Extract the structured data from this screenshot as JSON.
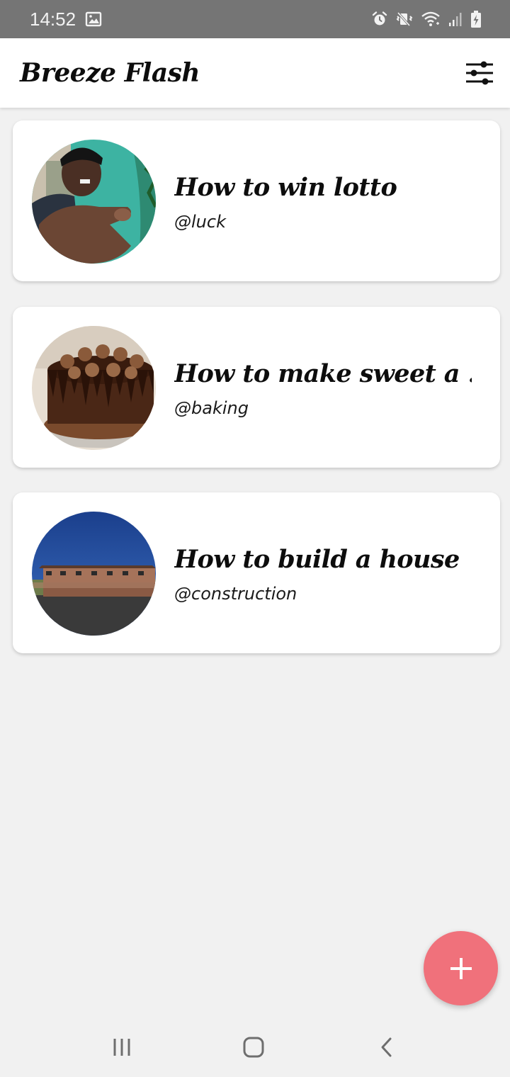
{
  "status_bar": {
    "time": "14:52",
    "icons": [
      "gallery-icon",
      "alarm-icon",
      "vibrate-mute-icon",
      "wifi-icon",
      "signal-icon",
      "battery-charging-icon"
    ]
  },
  "app_bar": {
    "title": "Breeze Flash",
    "filter_icon": "sliders-icon"
  },
  "cards": [
    {
      "title": "How to win lotto",
      "subtitle": "@luck",
      "image": "person-pointing-photo"
    },
    {
      "title": "How to make sweet a ...",
      "subtitle": "@baking",
      "image": "chocolate-cake-photo"
    },
    {
      "title": "How to build a house",
      "subtitle": "@construction",
      "image": "townhouse-photo"
    }
  ],
  "fab": {
    "icon": "plus-icon"
  },
  "nav_bar": {
    "icons": [
      "recent-apps-icon",
      "home-icon",
      "back-icon"
    ]
  },
  "colors": {
    "status_bar": "#757575",
    "background": "#f1f1f1",
    "card": "#ffffff",
    "fab": "#f0717b",
    "text": "#0d0d0d"
  }
}
